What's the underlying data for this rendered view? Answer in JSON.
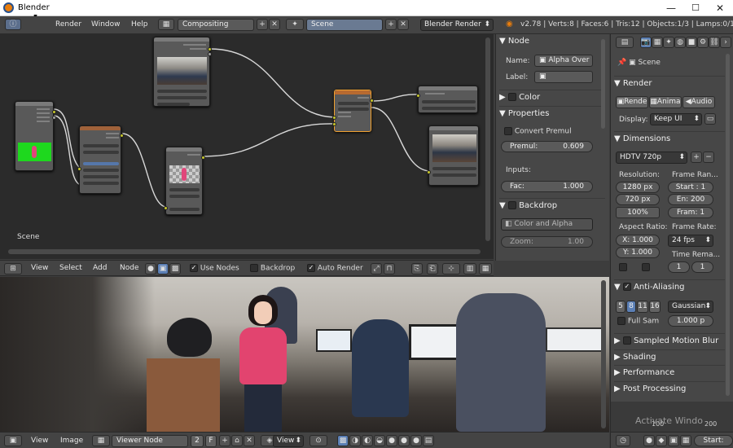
{
  "window": {
    "title": "Blender"
  },
  "info_header": {
    "menus": [
      "Render",
      "Window",
      "Help"
    ],
    "screen_layout": "Compositing",
    "scene": "Scene",
    "engine": "Blender Render",
    "stats": "v2.78 | Verts:8 | Faces:6 | Tris:12 | Objects:1/3 | Lamps:0/1 | Me"
  },
  "node_editor": {
    "scene_label": "Scene",
    "menus": [
      "View",
      "Select",
      "Add",
      "Node"
    ],
    "use_nodes": "Use Nodes",
    "backdrop": "Backdrop",
    "auto_render": "Auto Render"
  },
  "node_panel": {
    "node_header": "Node",
    "name_label": "Name:",
    "name_value": "Alpha Over",
    "label_label": "Label:",
    "label_value": "",
    "color_header": "Color",
    "properties_header": "Properties",
    "convert_premul": "Convert Premul",
    "premul_label": "Premul:",
    "premul_value": "0.609",
    "inputs_label": "Inputs:",
    "fac_label": "Fac:",
    "fac_value": "1.000",
    "backdrop_header": "Backdrop",
    "color_alpha": "Color and Alpha",
    "zoom_label": "Zoom:",
    "zoom_value": "1.00"
  },
  "image_editor": {
    "menus": [
      "View",
      "Image"
    ],
    "image_name": "Viewer Node",
    "users": "2",
    "fake_user": "F",
    "display": "View"
  },
  "properties": {
    "scene_label": "Scene",
    "render_header": "Render",
    "render_buttons": [
      "Rende",
      "Anima",
      "Audio"
    ],
    "display_label": "Display:",
    "display_value": "Keep UI",
    "dimensions_header": "Dimensions",
    "preset": "HDTV 720p",
    "resolution_label": "Resolution:",
    "res_x": "1280 px",
    "res_y": "720 px",
    "res_pct": "100%",
    "frame_range_label": "Frame Ran...",
    "start": "Start : 1",
    "end": "En: 200",
    "fram": "Fram: 1",
    "aspect_label": "Aspect Ratio:",
    "aspect_x": "X: 1.000",
    "aspect_y": "Y: 1.000",
    "frame_rate_label": "Frame Rate:",
    "fps": "24 fps",
    "time_remap_label": "Time Rema...",
    "remap_old": "1",
    "remap_new": "1",
    "aa_header": "Anti-Aliasing",
    "aa_samples": [
      "5",
      "8",
      "11",
      "16"
    ],
    "aa_filter": "Gaussian",
    "full_sample": "Full Sam",
    "filter_size": "1.000 p",
    "motion_blur": "Sampled Motion Blur",
    "shading": "Shading",
    "performance": "Performance",
    "post_processing": "Post Processing",
    "timeline_values": [
      "100",
      "200"
    ],
    "start_field": "Start:",
    "watermark": "Activate Windo"
  },
  "colors": {
    "accent": "#e87d0d",
    "panel": "#474747",
    "node_bg": "#2b2b2b",
    "socket": "#c7c729",
    "green_screen": "#1ed81e"
  }
}
